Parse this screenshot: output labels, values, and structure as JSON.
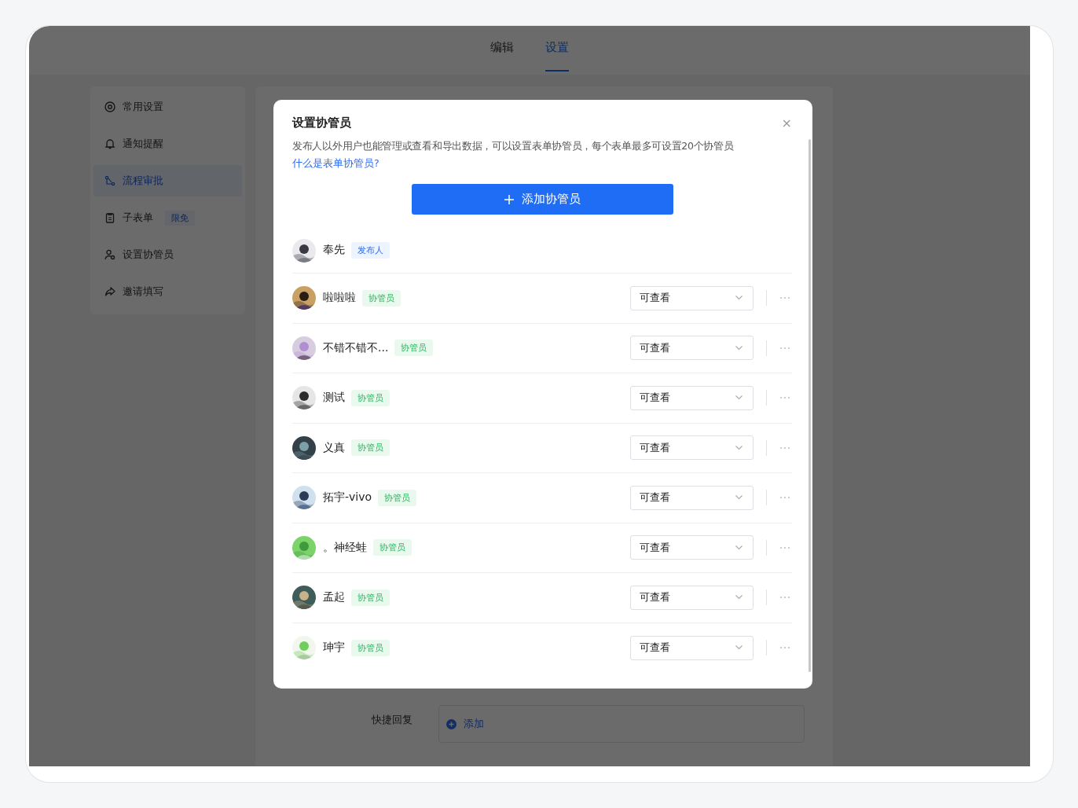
{
  "tabs": [
    {
      "label": "编辑",
      "selected": false
    },
    {
      "label": "设置",
      "selected": true
    }
  ],
  "sidebar": {
    "items": [
      {
        "label": "常用设置",
        "kind": "gear",
        "selected": false
      },
      {
        "label": "通知提醒",
        "kind": "bell",
        "selected": false
      },
      {
        "label": "流程审批",
        "kind": "flow",
        "selected": true
      },
      {
        "label": "子表单",
        "kind": "clipboard",
        "selected": false,
        "badge": "限免"
      },
      {
        "label": "设置协管员",
        "kind": "user",
        "selected": false
      },
      {
        "label": "邀请填写",
        "kind": "share",
        "selected": false
      }
    ]
  },
  "background_form": {
    "label": "快捷回复",
    "add_button": "添加"
  },
  "dialog": {
    "title": "设置协管员",
    "description": "发布人以外用户也能管理或查看和导出数据，可以设置表单协管员，每个表单最多可设置20个协管员",
    "help_link": "什么是表单协管员?",
    "add_button": "添加协管员",
    "close": "×",
    "members": [
      {
        "name": "奉先",
        "role": "发布人",
        "kind": "publisher"
      },
      {
        "name": "啦啦啦",
        "role": "协管员",
        "kind": "admin",
        "permission": "可查看"
      },
      {
        "name": "不错不错不...",
        "role": "协管员",
        "kind": "admin",
        "permission": "可查看"
      },
      {
        "name": "测试",
        "role": "协管员",
        "kind": "admin",
        "permission": "可查看"
      },
      {
        "name": "义真",
        "role": "协管员",
        "kind": "admin",
        "permission": "可查看"
      },
      {
        "name": "拓宇-vivo",
        "role": "协管员",
        "kind": "admin",
        "permission": "可查看"
      },
      {
        "name": "。神经蛙",
        "role": "协管员",
        "kind": "admin",
        "permission": "可查看"
      },
      {
        "name": "孟起",
        "role": "协管员",
        "kind": "admin",
        "permission": "可查看"
      },
      {
        "name": "珅宇",
        "role": "协管员",
        "kind": "admin",
        "permission": "可查看"
      }
    ]
  }
}
